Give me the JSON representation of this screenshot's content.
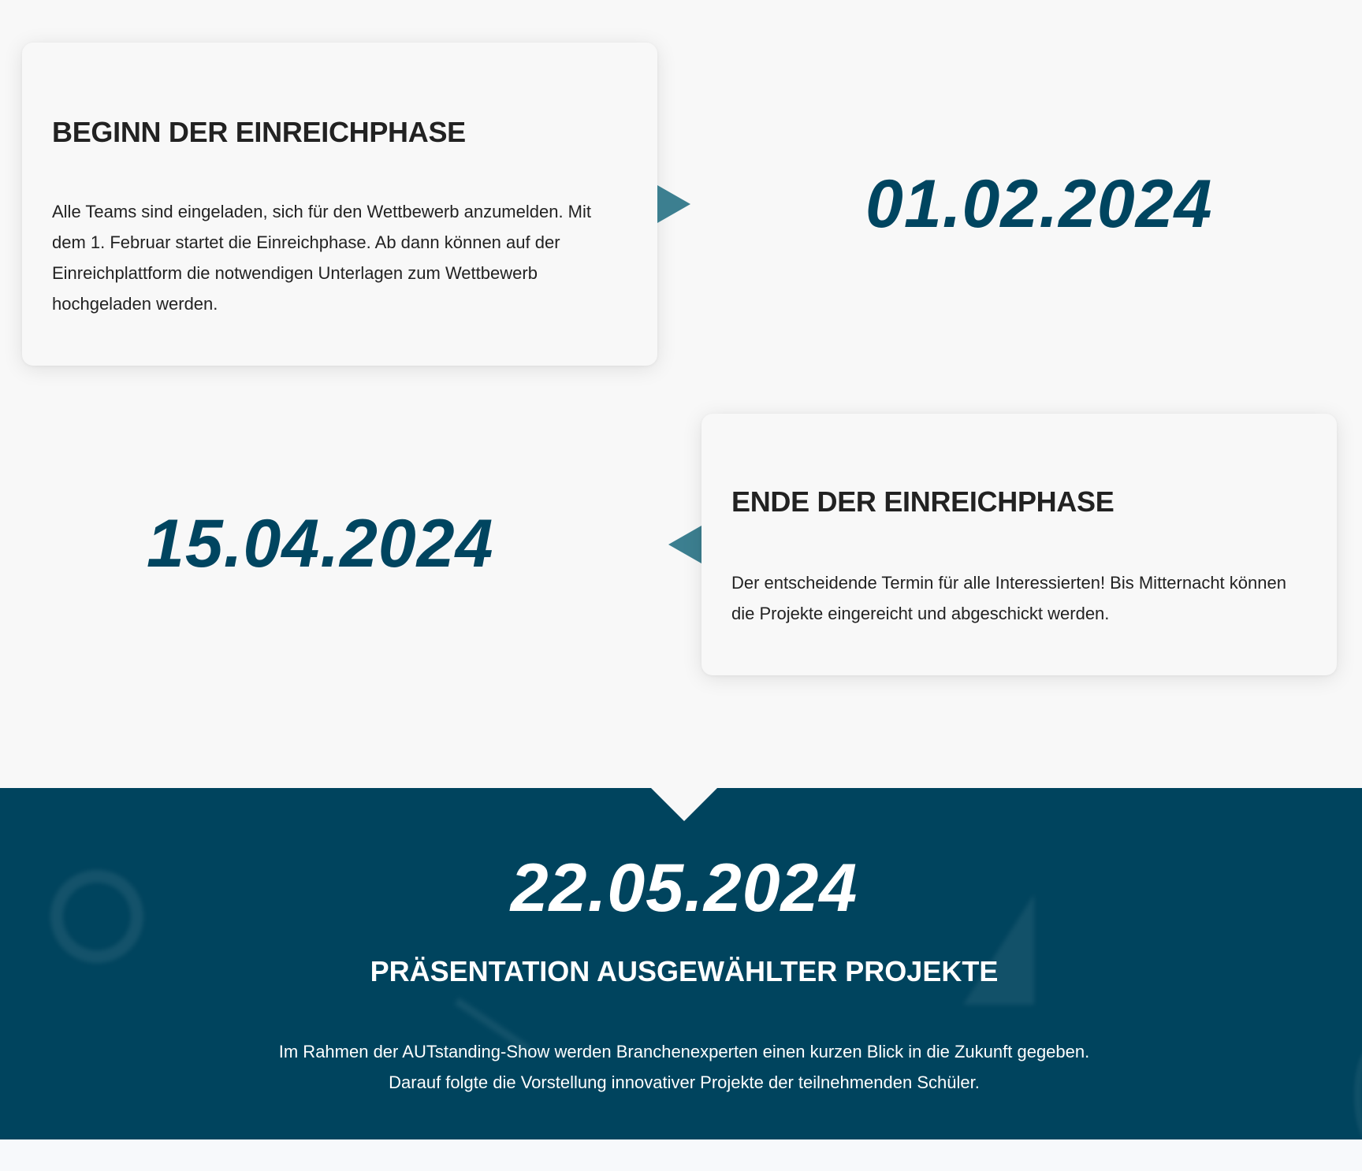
{
  "timeline": [
    {
      "date": "01.02.2024",
      "title": "BEGINN DER EINREICHPHASE",
      "text": "Alle Teams sind eingeladen, sich für den Wettbewerb anzumelden. Mit dem 1. Februar startet die Einreichphase. Ab dann können auf der Einreichplattform die notwendigen Unterlagen zum Wettbewerb hochgeladen werden."
    },
    {
      "date": "15.04.2024",
      "title": "ENDE DER EINREICHPHASE",
      "text": "Der entscheidende Termin für alle Interessierten! Bis Mitternacht können die Projekte eingereicht und abgeschickt werden."
    }
  ],
  "highlight": {
    "date": "22.05.2024",
    "title": "PRÄSENTATION AUSGEWÄHLTER PROJEKTE",
    "text": "Im Rahmen der AUTstanding-Show werden Branchenexperten einen kurzen Blick in die Zukunft gegeben. Darauf folgte die Vorstellung innovativer Projekte der teilnehmenden Schüler."
  },
  "colors": {
    "accent": "#004560",
    "arrow": "#3c7f90",
    "band_background": "#00445e",
    "page_background": "#f8f8f8",
    "text": "#222222"
  }
}
